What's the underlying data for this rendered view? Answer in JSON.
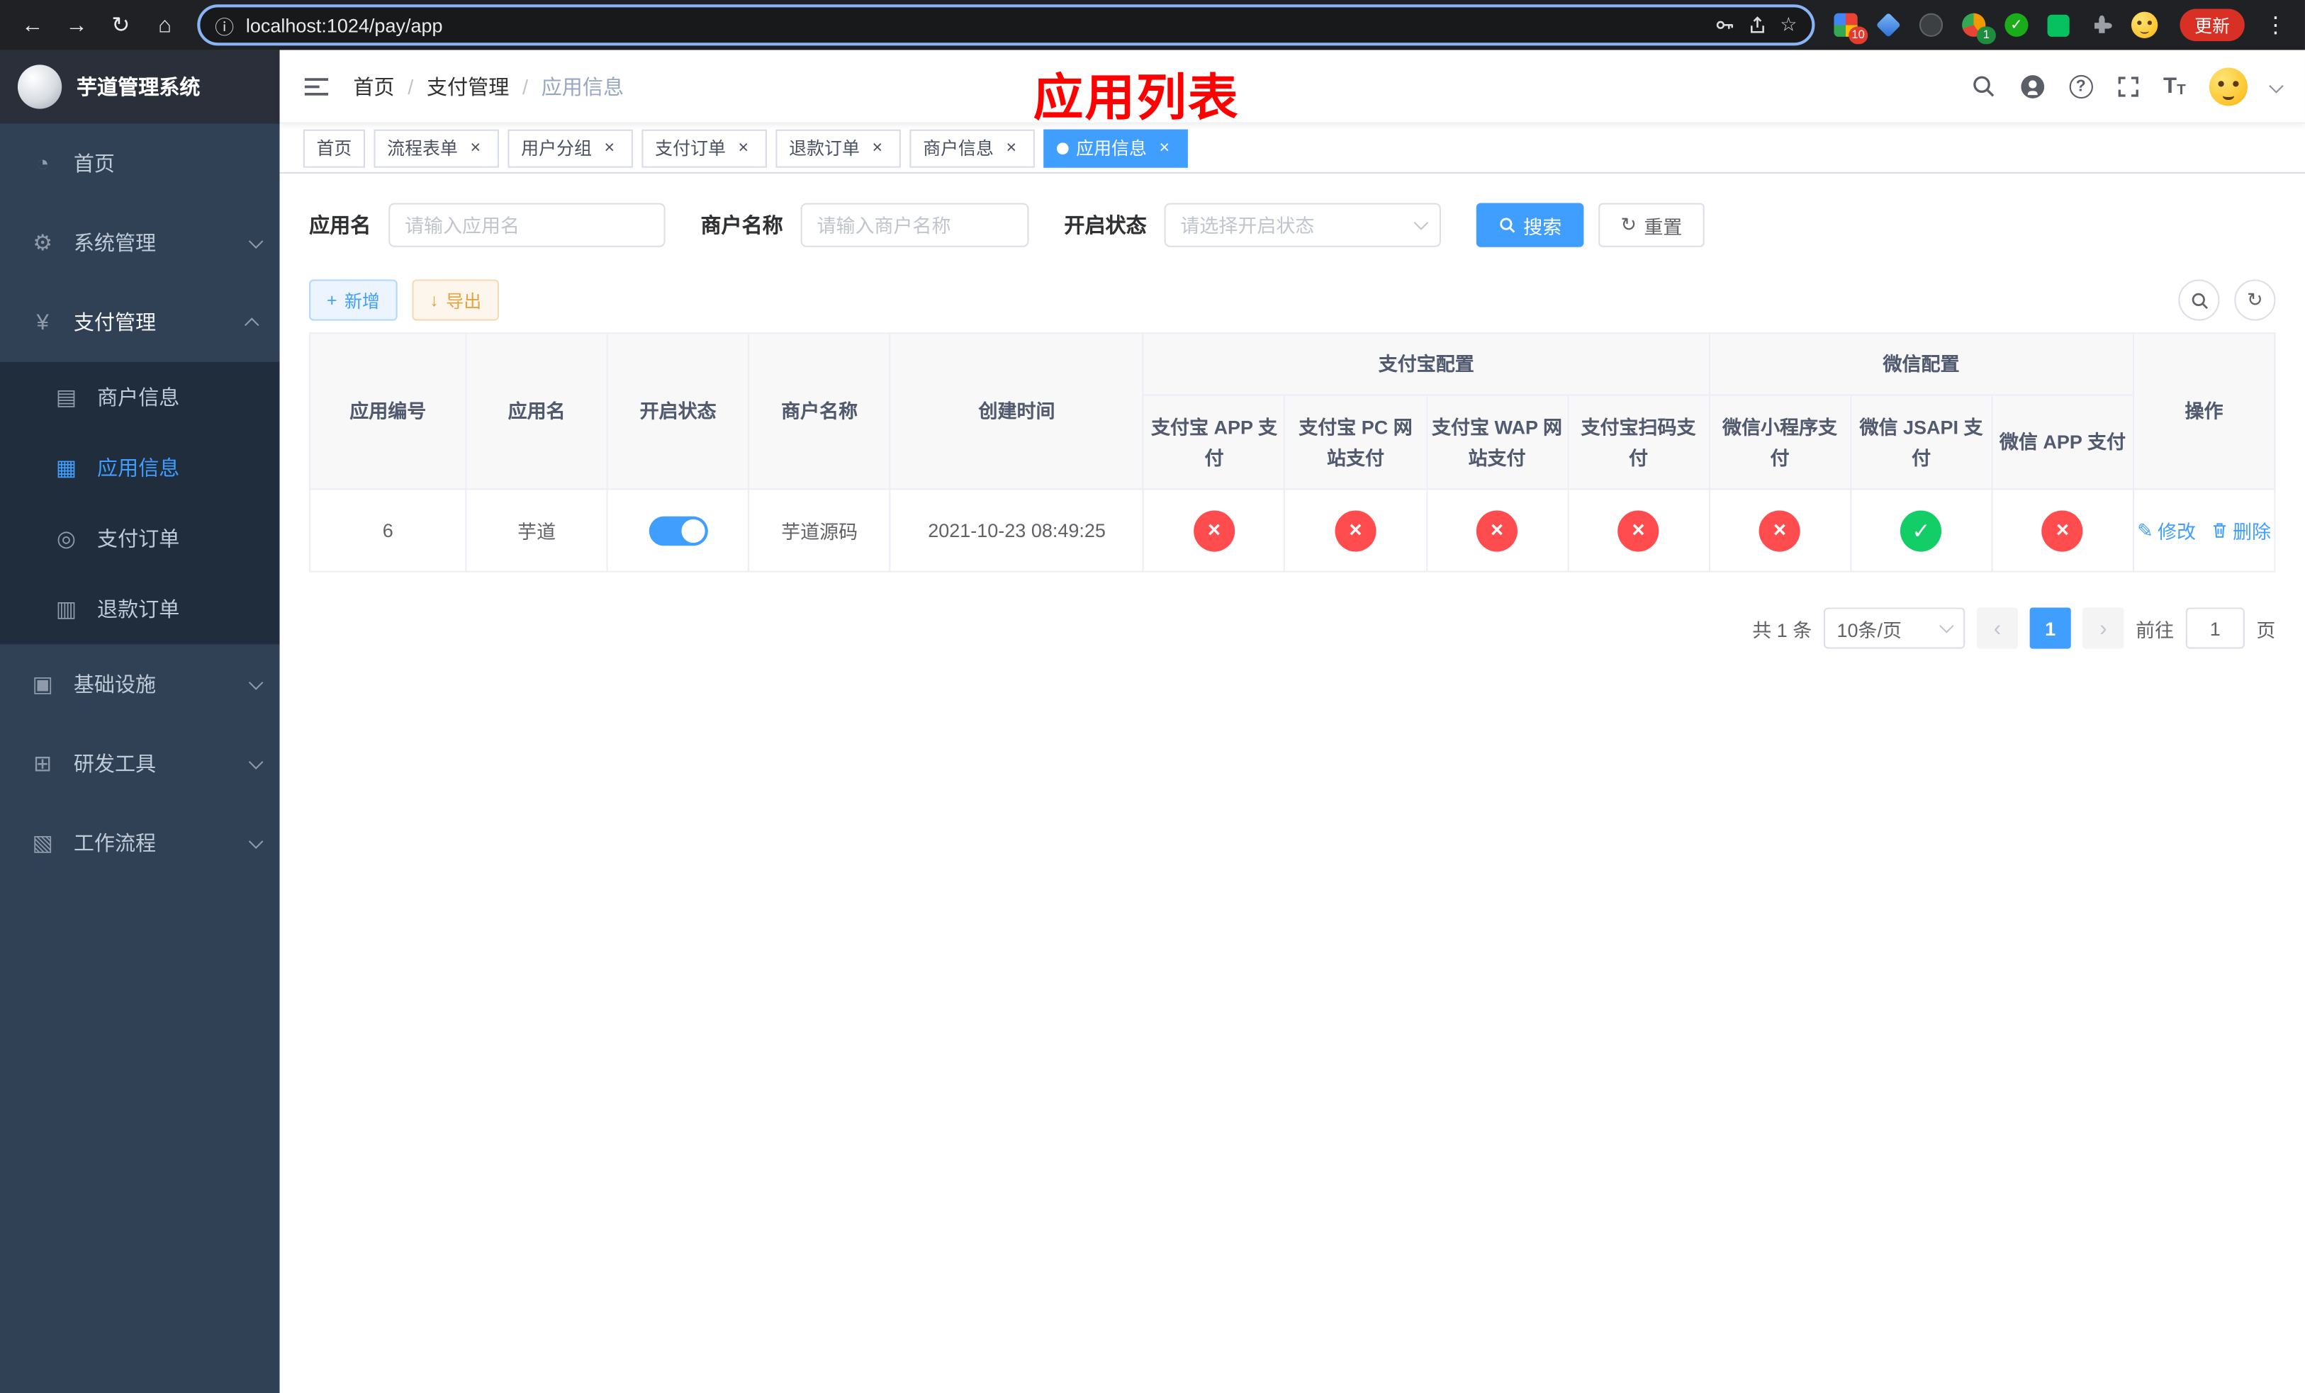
{
  "colors": {
    "accent": "#409eff",
    "danger": "#ff4d4f",
    "success": "#13ce66",
    "sidebar_bg": "#304156",
    "submenu_bg": "#1f2d3d",
    "overlay_title_red": "#ff0000",
    "chrome_bg": "#202124",
    "update_pill_red": "#d93025"
  },
  "icons": {
    "back": "←",
    "forward": "→",
    "reload": "↻",
    "home": "⌂",
    "info": "ⓘ",
    "star": "☆",
    "menu_dots": "⋮",
    "dashboard": "◔",
    "gear": "⚙",
    "yen": "¥",
    "merchant": "▤",
    "app_grid": "▦",
    "order": "◎",
    "refund": "▥",
    "infra": "▣",
    "tools": "⊞",
    "workflow": "▧",
    "close": "×",
    "cross": "×",
    "check": "✓",
    "plus": "+",
    "download": "↓",
    "reset": "↻",
    "refresh": "↻",
    "edit_pencil": "✎",
    "question": "?",
    "font_big": "T",
    "font_small": "T",
    "prev": "‹",
    "next": "›"
  },
  "browser": {
    "url": "localhost:1024/pay/app",
    "update_label": "更新",
    "grid_badge": "10",
    "avatar_badge": "1"
  },
  "sidebar": {
    "title": "芋道管理系统",
    "menu": [
      {
        "label": "首页"
      },
      {
        "label": "系统管理"
      },
      {
        "label": "支付管理"
      },
      {
        "label": "商户信息"
      },
      {
        "label": "应用信息"
      },
      {
        "label": "支付订单"
      },
      {
        "label": "退款订单"
      },
      {
        "label": "基础设施"
      },
      {
        "label": "研发工具"
      },
      {
        "label": "工作流程"
      }
    ]
  },
  "header": {
    "breadcrumb": [
      "首页",
      "支付管理",
      "应用信息"
    ],
    "overlay_title": "应用列表"
  },
  "tabs": [
    {
      "label": "首页"
    },
    {
      "label": "流程表单"
    },
    {
      "label": "用户分组"
    },
    {
      "label": "支付订单"
    },
    {
      "label": "退款订单"
    },
    {
      "label": "商户信息"
    },
    {
      "label": "应用信息"
    }
  ],
  "filters": {
    "app_name_label": "应用名",
    "app_name_placeholder": "请输入应用名",
    "merchant_label": "商户名称",
    "merchant_placeholder": "请输入商户名称",
    "status_label": "开启状态",
    "status_placeholder": "请选择开启状态",
    "search_label": "搜索",
    "reset_label": "重置"
  },
  "toolbar": {
    "add_label": "新增",
    "export_label": "导出"
  },
  "table": {
    "headers": {
      "app_id": "应用编号",
      "app_name": "应用名",
      "status": "开启状态",
      "merchant": "商户名称",
      "create_time": "创建时间",
      "alipay_group": "支付宝配置",
      "wechat_group": "微信配置",
      "alipay_app": "支付宝 APP 支付",
      "alipay_pc": "支付宝 PC 网站支付",
      "alipay_wap": "支付宝 WAP 网站支付",
      "alipay_qr": "支付宝扫码支付",
      "wx_mini": "微信小程序支付",
      "wx_jsapi": "微信 JSAPI 支付",
      "wx_app": "微信 APP 支付",
      "actions": "操作"
    },
    "rows": [
      {
        "app_id": "6",
        "app_name": "芋道",
        "status_on": true,
        "merchant": "芋道源码",
        "create_time": "2021-10-23 08:49:25",
        "alipay_app": "disabled",
        "alipay_pc": "disabled",
        "alipay_wap": "disabled",
        "alipay_qr": "disabled",
        "wx_mini": "disabled",
        "wx_jsapi": "enabled",
        "wx_app": "disabled",
        "edit_label": "修改",
        "delete_label": "删除"
      }
    ]
  },
  "pagination": {
    "total_text": "共 1 条",
    "page_size": "10条/页",
    "current_page": "1",
    "goto_prefix": "前往",
    "goto_value": "1",
    "goto_suffix": "页"
  }
}
